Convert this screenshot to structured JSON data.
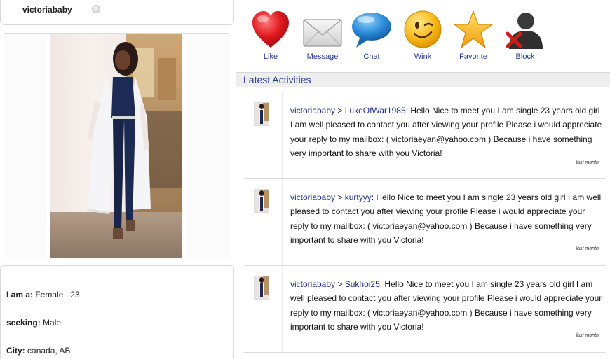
{
  "profile": {
    "username": "victoriababy",
    "details": [
      {
        "label": "I am a:",
        "value": "Female , 23"
      },
      {
        "label": "seeking:",
        "value": "Male"
      },
      {
        "label": "City:",
        "value": "canada, AB"
      }
    ]
  },
  "actions": [
    {
      "label": "Like",
      "icon": "heart-icon"
    },
    {
      "label": "Message",
      "icon": "envelope-icon"
    },
    {
      "label": "Chat",
      "icon": "speech-bubble-icon"
    },
    {
      "label": "Wink",
      "icon": "wink-face-icon"
    },
    {
      "label": "Favorite",
      "icon": "star-icon"
    },
    {
      "label": "Block",
      "icon": "block-user-icon"
    }
  ],
  "latest": {
    "title": "Latest Activities",
    "items": [
      {
        "from": "victoriababy",
        "arrow": " > ",
        "to": "LukeOfWar1985",
        "text": ": Hello Nice to meet you I am single 23 years old girl I am well pleased to contact you after viewing your profile Please i would appreciate your reply to my mailbox: ( victoriaeyan@yahoo.com ) Because i have something very important to share with you Victoria!",
        "time": "last month"
      },
      {
        "from": "victoriababy",
        "arrow": " > ",
        "to": "kurtyyy",
        "text": ": Hello Nice to meet you I am single 23 years old girl I am well pleased to contact you after viewing your profile Please i would appreciate your reply to my mailbox: ( victoriaeyan@yahoo.com ) Because i have something very important to share with you Victoria!",
        "time": "last month"
      },
      {
        "from": "victoriababy",
        "arrow": " > ",
        "to": "Sukhoi25",
        "text": ": Hello Nice to meet you I am single 23 years old girl I am well pleased to contact you after viewing your profile Please i would appreciate your reply to my mailbox: ( victoriaeyan@yahoo.com ) Because i have something very important to share with you Victoria!",
        "time": "last month"
      }
    ]
  },
  "colors": {
    "link": "#1e2f8c",
    "header_bg": "#eeeeee",
    "heart": "#d8141b",
    "star": "#f6b21a",
    "bubble": "#2f8fd8",
    "wink": "#f7b818"
  }
}
